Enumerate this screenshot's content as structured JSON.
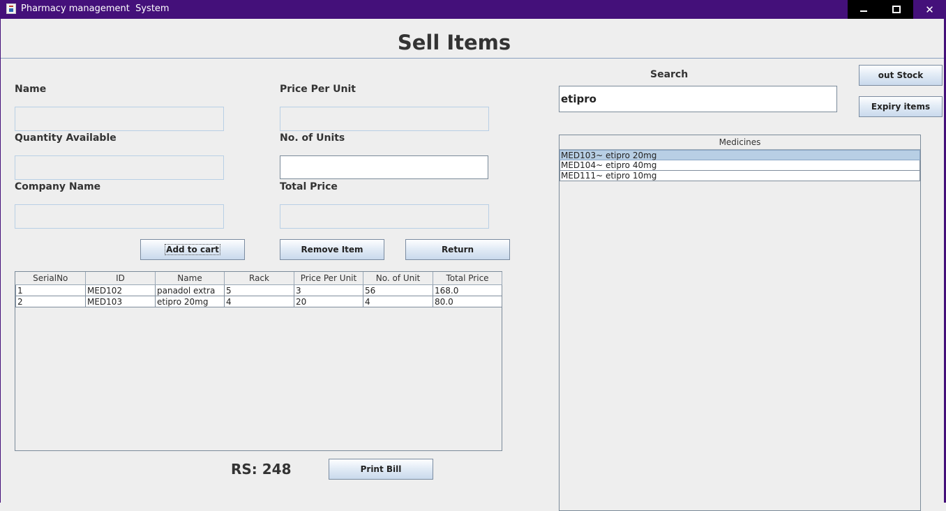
{
  "window": {
    "title": "Pharmacy management  System",
    "controls": {
      "minimize": "minimize",
      "maximize": "maximize",
      "close": "✕"
    }
  },
  "page": {
    "title": "Sell Items"
  },
  "form": {
    "name_label": "Name",
    "price_per_unit_label": "Price Per Unit",
    "quantity_available_label": "Quantity Available",
    "no_of_units_label": "No. of Units",
    "company_name_label": "Company Name",
    "total_price_label": "Total Price",
    "name_value": "",
    "price_per_unit_value": "",
    "quantity_available_value": "",
    "no_of_units_value": "",
    "company_name_value": "",
    "total_price_value": ""
  },
  "buttons": {
    "add_to_cart": "Add to cart",
    "remove_item": "Remove Item",
    "return": "Return",
    "out_stock": "out Stock",
    "expiry_items": "Expiry items",
    "print_bill": "Print Bill"
  },
  "cart": {
    "columns": [
      "SerialNo",
      "ID",
      "Name",
      "Rack",
      "Price Per Unit",
      "No. of Unit",
      "Total Price"
    ],
    "rows": [
      [
        "1",
        "MED102",
        "panadol extra",
        "5",
        "3",
        "56",
        "168.0"
      ],
      [
        "2",
        "MED103",
        "etipro 20mg",
        "4",
        "20",
        "4",
        "80.0"
      ]
    ]
  },
  "search": {
    "label": "Search",
    "value": "etipro"
  },
  "medicines": {
    "header": "Medicines",
    "items": [
      "MED103~ etipro 20mg",
      "MED104~ etipro 40mg",
      "MED111~ etipro 10mg"
    ],
    "selected_index": 0
  },
  "total": {
    "text": "RS: 248"
  },
  "colors": {
    "titlebar": "#44107a",
    "selection": "#b8cfe5",
    "background": "#eeeeee"
  }
}
